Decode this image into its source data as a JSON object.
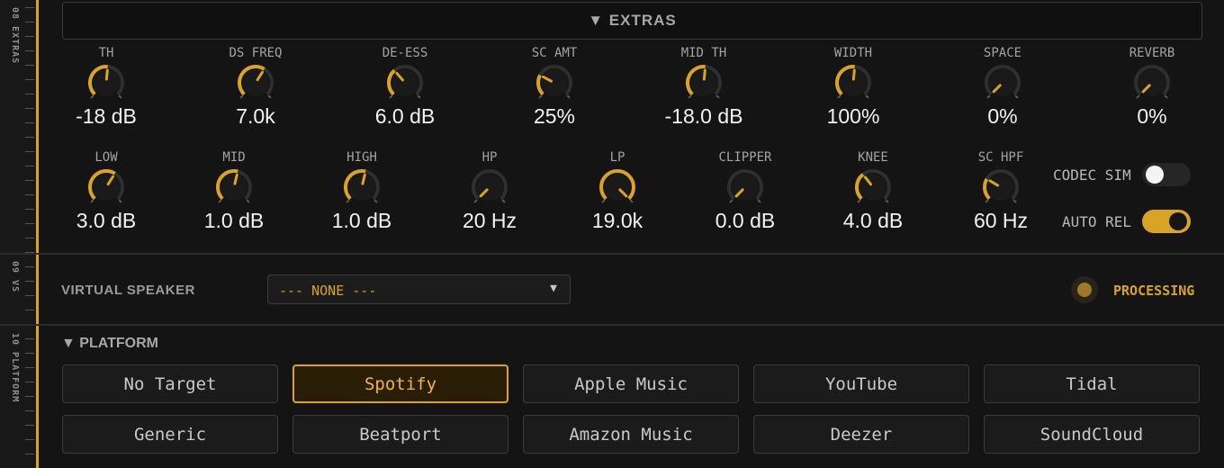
{
  "rail": {
    "sections": [
      {
        "label": "08 EXTRAS"
      },
      {
        "label": "09 VS"
      },
      {
        "label": "10 PLATFORM"
      }
    ]
  },
  "extras": {
    "header": "▼ EXTRAS",
    "knobs_row1": [
      {
        "label": "TH",
        "value": "-18 dB",
        "level": 0.52
      },
      {
        "label": "DS FREQ",
        "value": "7.0k",
        "level": 0.62
      },
      {
        "label": "DE-ESS",
        "value": "6.0 dB",
        "level": 0.35
      },
      {
        "label": "SC AMT",
        "value": "25%",
        "level": 0.27
      },
      {
        "label": "MID TH",
        "value": "-18.0 dB",
        "level": 0.52
      },
      {
        "label": "WIDTH",
        "value": "100%",
        "level": 0.52
      },
      {
        "label": "SPACE",
        "value": "0%",
        "level": 0.0
      },
      {
        "label": "REVERB",
        "value": "0%",
        "level": 0.0
      }
    ],
    "knobs_row2": [
      {
        "label": "LOW",
        "value": "3.0 dB",
        "level": 0.62
      },
      {
        "label": "MID",
        "value": "1.0 dB",
        "level": 0.55
      },
      {
        "label": "HIGH",
        "value": "1.0 dB",
        "level": 0.55
      },
      {
        "label": "HP",
        "value": "20 Hz",
        "level": 0.0
      },
      {
        "label": "LP",
        "value": "19.0k",
        "level": 1.0
      },
      {
        "label": "CLIPPER",
        "value": "0.0 dB",
        "level": 0.0
      },
      {
        "label": "KNEE",
        "value": "4.0 dB",
        "level": 0.36
      },
      {
        "label": "SC HPF",
        "value": "60 Hz",
        "level": 0.28
      }
    ],
    "toggles": [
      {
        "label": "CODEC SIM",
        "on": false
      },
      {
        "label": "AUTO REL",
        "on": true
      }
    ]
  },
  "virtual_speaker": {
    "label": "VIRTUAL SPEAKER",
    "selected": "--- NONE ---",
    "status": "PROCESSING"
  },
  "platform": {
    "title": "▼ PLATFORM",
    "buttons": [
      {
        "label": "No Target",
        "active": false
      },
      {
        "label": "Spotify",
        "active": true
      },
      {
        "label": "Apple Music",
        "active": false
      },
      {
        "label": "YouTube",
        "active": false
      },
      {
        "label": "Tidal",
        "active": false
      },
      {
        "label": "Generic",
        "active": false
      },
      {
        "label": "Beatport",
        "active": false
      },
      {
        "label": "Amazon Music",
        "active": false
      },
      {
        "label": "Deezer",
        "active": false
      },
      {
        "label": "SoundCloud",
        "active": false
      }
    ]
  },
  "colors": {
    "accent": "#d9a325",
    "knob_track": "#2f2f2f",
    "knob_body": "#1a1a1a"
  }
}
